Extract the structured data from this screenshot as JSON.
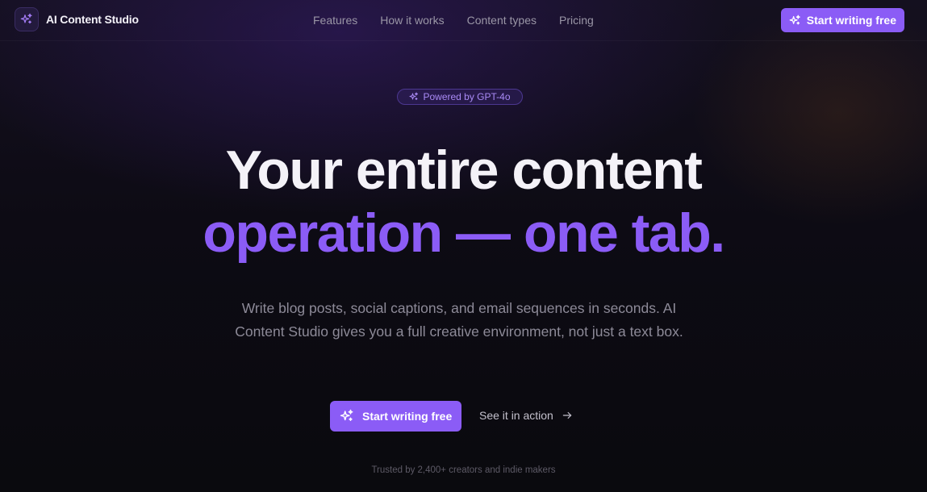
{
  "nav": {
    "brand": "AI Content Studio",
    "links": [
      "Features",
      "How it works",
      "Content types",
      "Pricing"
    ],
    "cta_label": "Start writing free"
  },
  "hero": {
    "badge": "Powered by GPT-4o",
    "headline_line1": "Your entire content",
    "headline_line2": "operation — one tab.",
    "subtitle": "Write blog posts, social captions, and email sequences in seconds. AI Content Studio gives you a full creative environment, not just a text box.",
    "primary_cta": "Start writing free",
    "secondary_cta": "See it in action",
    "trust_line": "Trusted by 2,400+ creators and indie makers"
  },
  "icons": {
    "logo": "sparkles-icon",
    "badge": "sparkles-icon",
    "cta": "sparkles-icon",
    "secondary": "arrow-right-icon"
  },
  "colors": {
    "accent": "#8b5cf6",
    "background": "#0b0a10",
    "headline": "#f4f2f8",
    "muted_text": "#8d8a98"
  }
}
